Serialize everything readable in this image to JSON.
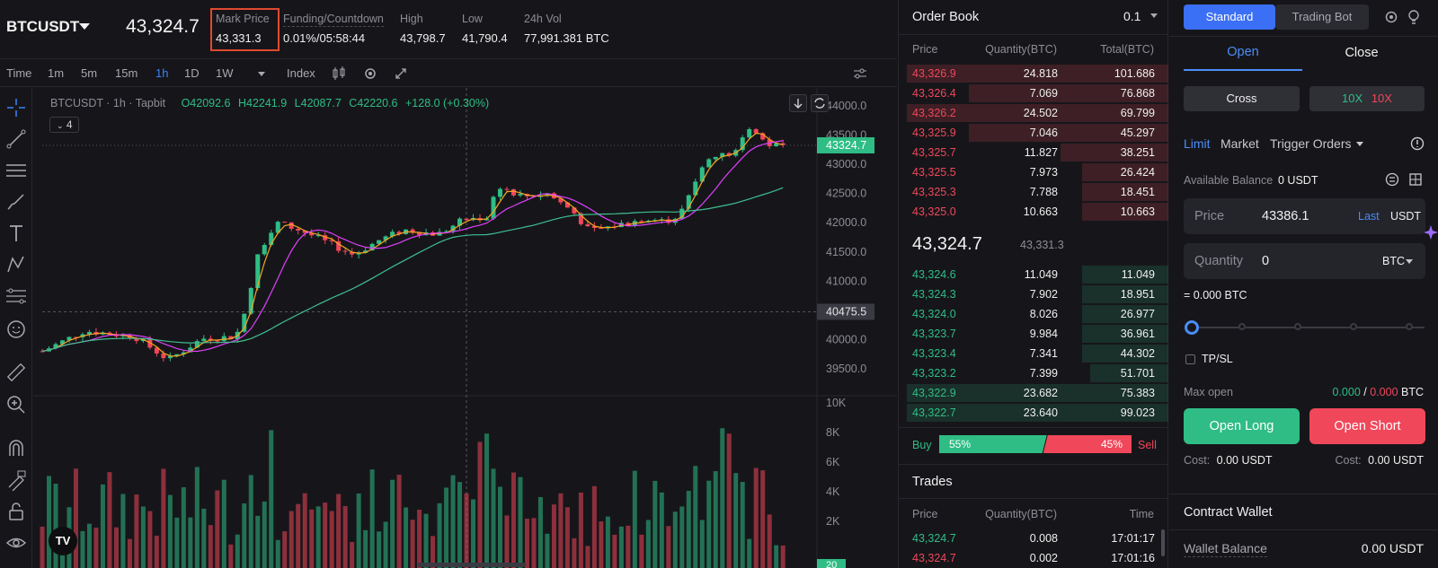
{
  "header": {
    "symbol": "BTCUSDT",
    "last_price": "43,324.7",
    "stats": [
      {
        "label": "Mark Price",
        "value": "43,331.3"
      },
      {
        "label": "Funding/Countdown",
        "value": "0.01%/05:58:44"
      },
      {
        "label": "High",
        "value": "43,798.7"
      },
      {
        "label": "Low",
        "value": "41,790.4"
      },
      {
        "label": "24h Vol",
        "value": "77,991.381",
        "unit": "BTC"
      }
    ]
  },
  "timeframes": {
    "items": [
      "Time",
      "1m",
      "5m",
      "15m",
      "1h",
      "1D",
      "1W"
    ],
    "active": "1h",
    "index_label": "Index"
  },
  "chart": {
    "legend_symbol": "BTCUSDT",
    "legend_interval": "1h",
    "legend_source": "Tapbit",
    "ohlc": {
      "open": "O42092.6",
      "high": "H42241.9",
      "low": "L42087.7",
      "close": "C42220.6",
      "change": "+128.0 (+0.30%)"
    },
    "indicator_count": "4",
    "price_ticks": [
      "44000.0",
      "43500.0",
      "43000.0",
      "42500.0",
      "42000.0",
      "41500.0",
      "41000.0",
      "40000.0",
      "39500.0"
    ],
    "last_tag": "43324.7",
    "crosshair_tag": "40475.5",
    "volume_ticks": [
      "10K",
      "8K",
      "6K",
      "4K",
      "2K"
    ],
    "volume_tag": "20",
    "logo": "TV",
    "colors": {
      "up": "#2fbd85",
      "down": "#f0475a",
      "ma_fast": "#f5a623",
      "ma_mid": "#e040fb",
      "ma_slow": "#3fbf8f"
    }
  },
  "orderbook": {
    "title": "Order Book",
    "precision": "0.1",
    "columns": [
      "Price",
      "Quantity(BTC)",
      "Total(BTC)"
    ],
    "asks": [
      {
        "price": "43,326.9",
        "qty": "24.818",
        "total": "101.686",
        "depth": 0.97
      },
      {
        "price": "43,326.4",
        "qty": "7.069",
        "total": "76.868",
        "depth": 0.74
      },
      {
        "price": "43,326.2",
        "qty": "24.502",
        "total": "69.799",
        "depth": 0.97
      },
      {
        "price": "43,325.9",
        "qty": "7.046",
        "total": "45.297",
        "depth": 0.74
      },
      {
        "price": "43,325.7",
        "qty": "11.827",
        "total": "38.251",
        "depth": 0.4
      },
      {
        "price": "43,325.5",
        "qty": "7.973",
        "total": "26.424",
        "depth": 0.32
      },
      {
        "price": "43,325.3",
        "qty": "7.788",
        "total": "18.451",
        "depth": 0.32
      },
      {
        "price": "43,325.0",
        "qty": "10.663",
        "total": "10.663",
        "depth": 0.32
      }
    ],
    "mid_price": "43,324.7",
    "mid_mark": "43,331.3",
    "bids": [
      {
        "price": "43,324.6",
        "qty": "11.049",
        "total": "11.049",
        "depth": 0.32
      },
      {
        "price": "43,324.3",
        "qty": "7.902",
        "total": "18.951",
        "depth": 0.32
      },
      {
        "price": "43,324.0",
        "qty": "8.026",
        "total": "26.977",
        "depth": 0.32
      },
      {
        "price": "43,323.7",
        "qty": "9.984",
        "total": "36.961",
        "depth": 0.32
      },
      {
        "price": "43,323.4",
        "qty": "7.341",
        "total": "44.302",
        "depth": 0.32
      },
      {
        "price": "43,323.2",
        "qty": "7.399",
        "total": "51.701",
        "depth": 0.29
      },
      {
        "price": "43,322.9",
        "qty": "23.682",
        "total": "75.383",
        "depth": 0.97
      },
      {
        "price": "43,322.7",
        "qty": "23.640",
        "total": "99.023",
        "depth": 0.97
      }
    ],
    "buy_label": "Buy",
    "sell_label": "Sell",
    "buy_pct": "55%",
    "sell_pct": "45%",
    "buy_fraction": 0.55
  },
  "trades": {
    "title": "Trades",
    "columns": [
      "Price",
      "Quantity(BTC)",
      "Time"
    ],
    "rows": [
      {
        "price": "43,324.7",
        "qty": "0.008",
        "time": "17:01:17",
        "side": "buy"
      },
      {
        "price": "43,324.7",
        "qty": "0.002",
        "time": "17:01:16",
        "side": "sell"
      }
    ]
  },
  "panel": {
    "mode_tabs": [
      "Standard",
      "Trading Bot"
    ],
    "active_mode": "Standard",
    "side_tabs": [
      "Open",
      "Close"
    ],
    "margin_mode": "Cross",
    "leverage_long": "10X",
    "leverage_short": "10X",
    "order_types": [
      "Limit",
      "Market",
      "Trigger Orders"
    ],
    "available_label": "Available Balance",
    "available_value": "0 USDT",
    "price_label": "Price",
    "price_value": "43386.1",
    "price_last": "Last",
    "price_unit": "USDT",
    "qty_label": "Quantity",
    "qty_value": "0",
    "qty_unit": "BTC",
    "qty_equiv": "= 0.000 BTC",
    "slider_fraction": 0,
    "tpsl_label": "TP/SL",
    "max_open_label": "Max open",
    "max_long": "0.000",
    "max_sep": "/",
    "max_short": "0.000",
    "max_unit": "BTC",
    "open_long": "Open Long",
    "open_short": "Open Short",
    "cost_label": "Cost:",
    "cost_long": "0.00 USDT",
    "cost_short": "0.00 USDT",
    "wallet_title": "Contract Wallet",
    "wallet_balance_label": "Wallet Balance",
    "wallet_balance_value": "0.00 USDT"
  }
}
